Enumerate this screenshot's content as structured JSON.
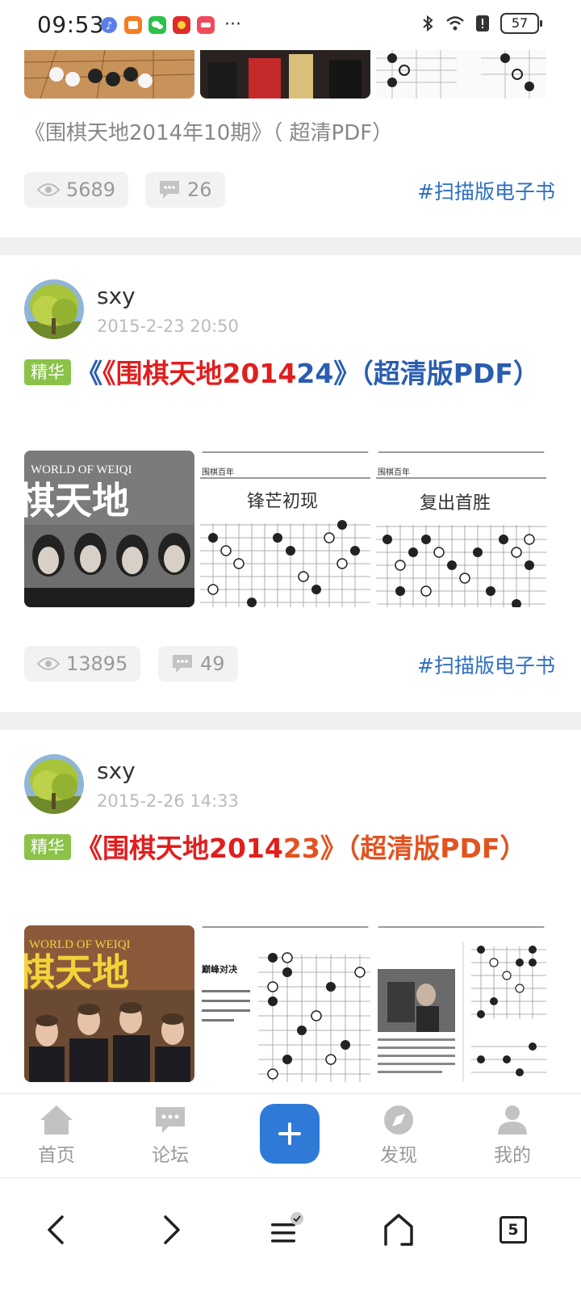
{
  "status": {
    "time": "09:53",
    "battery": "57"
  },
  "posts": [
    {
      "caption": "《围棋天地2014年10期》（ 超清PDF）",
      "views": "5689",
      "comments": "26",
      "tag": "#扫描版电子书"
    },
    {
      "author": "sxy",
      "date": "2015-2-23 20:50",
      "badge": "精华",
      "title_red": "《围棋天地2014",
      "title_blue": "24》（超清版PDF）",
      "title_color_red": "#e01e1e",
      "title_color_blue": "#2a5db0",
      "thumb_text": "WORLD OF WEIQI",
      "thumb_logo": "棋天地",
      "page2_header": "围棋百年",
      "page2_title": "锋芒初现",
      "page3_header": "围棋百年",
      "page3_title": "复出首胜",
      "views": "13895",
      "comments": "49",
      "tag": "#扫描版电子书"
    },
    {
      "author": "sxy",
      "date": "2015-2-26 14:33",
      "badge": "精华",
      "title_red": "《围棋天地2014",
      "title_orange": "23》（超清版PDF）",
      "title_color_red": "#e01e1e",
      "title_color_orange": "#e2531f",
      "thumb_text": "WORLD OF WEIQI",
      "thumb_logo": "棋天地",
      "page2_title": "巅峰对决"
    }
  ],
  "app_nav": {
    "home": "首页",
    "forum": "论坛",
    "discover": "发现",
    "mine": "我的"
  },
  "browser": {
    "tab_count": "5"
  },
  "colors": {
    "accent": "#2e7ad6",
    "tag_link": "#2d6fc4",
    "badge_green": "#8bc34a"
  }
}
